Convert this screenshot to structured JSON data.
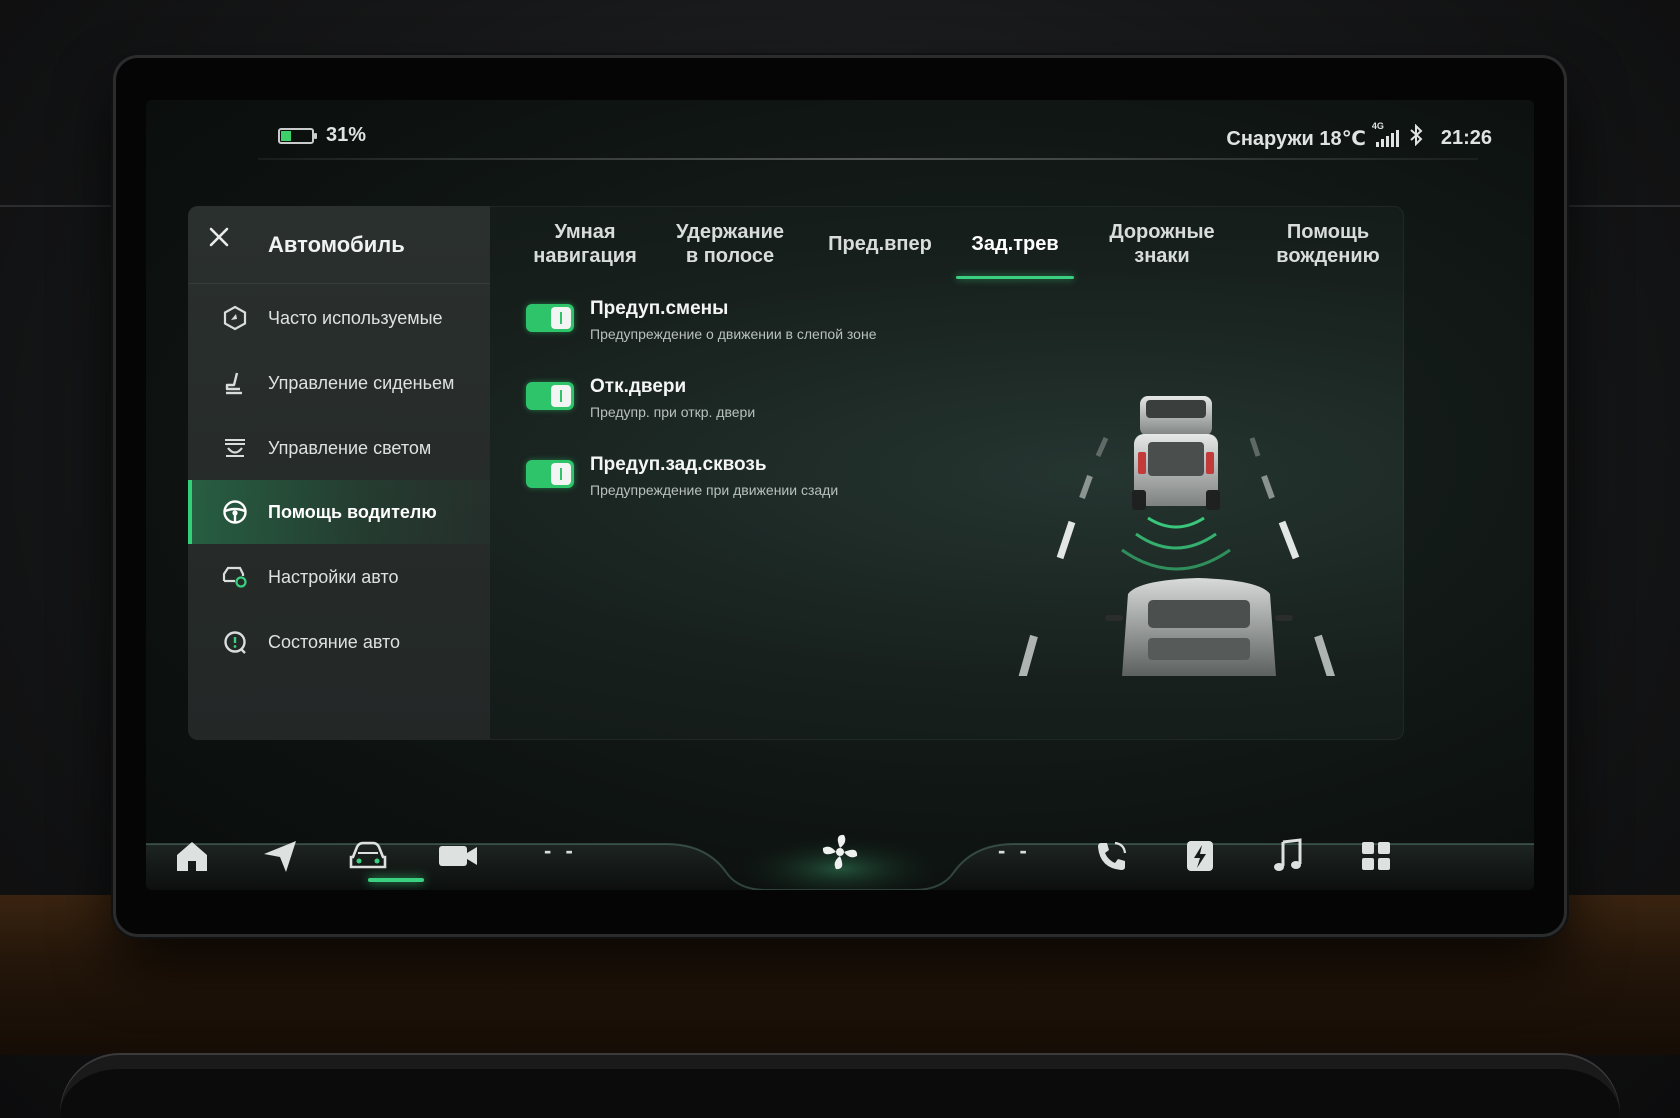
{
  "status": {
    "battery_percent": "31%",
    "battery_level": 0.31,
    "outside_temp": "Снаружи 18℃",
    "network": "4G",
    "time": "21:26"
  },
  "sidebar": {
    "title": "Автомобиль",
    "items": [
      {
        "label": "Часто используемые",
        "icon": "hexagon-icon"
      },
      {
        "label": "Управление сиденьем",
        "icon": "seat-icon"
      },
      {
        "label": "Управление светом",
        "icon": "headlight-icon"
      },
      {
        "label": "Помощь водителю",
        "icon": "steering-wheel-icon",
        "active": true
      },
      {
        "label": "Настройки авто",
        "icon": "car-settings-icon"
      },
      {
        "label": "Состояние авто",
        "icon": "car-status-icon"
      }
    ]
  },
  "tabs": [
    {
      "label": "Умная\nнавигация"
    },
    {
      "label": "Удержание\nв полосе"
    },
    {
      "label": "Пред.впер"
    },
    {
      "label": "Зад.трев",
      "active": true
    },
    {
      "label": "Дорожные\nзнаки"
    },
    {
      "label": "Помощь\nвождению"
    }
  ],
  "settings": [
    {
      "title": "Предуп.смены",
      "subtitle": "Предупреждение о движении в слепой зоне",
      "enabled": true
    },
    {
      "title": "Отк.двери",
      "subtitle": "Предупр. при откр. двери",
      "enabled": true
    },
    {
      "title": "Предуп.зад.сквозь",
      "subtitle": "Предупреждение при движении сзади",
      "enabled": true
    }
  ],
  "dock": {
    "left_temp": "- -",
    "right_temp": "- -",
    "items": [
      "home-icon",
      "navigation-icon",
      "car-icon",
      "camera-icon",
      "fan-icon",
      "phone-icon",
      "charging-icon",
      "music-icon",
      "apps-icon"
    ]
  },
  "colors": {
    "accent": "#3ad07f",
    "toggle_on": "#2ec46a"
  }
}
